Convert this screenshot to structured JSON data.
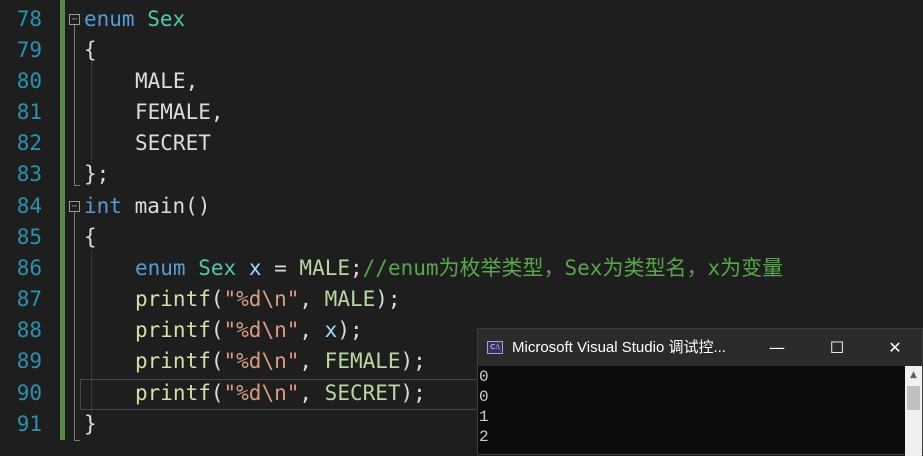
{
  "editor": {
    "line_numbers": [
      "78",
      "79",
      "80",
      "81",
      "82",
      "83",
      "84",
      "85",
      "86",
      "87",
      "88",
      "89",
      "90",
      "91"
    ],
    "code": {
      "l78_kw": "enum",
      "l78_name": "Sex",
      "l79": "{",
      "l80": "MALE,",
      "l81": "FEMALE,",
      "l82": "SECRET",
      "l83": "};",
      "l84_kw": "int",
      "l84_rest": "main()",
      "l85": "{",
      "l86_kw": "enum",
      "l86_type": "Sex",
      "l86_var": "x",
      "l86_eq": " = ",
      "l86_val": "MALE",
      "l86_semi": ";",
      "l86_comment": "//enum为枚举类型，Sex为类型名，x为变量",
      "printf": "printf",
      "open": "(",
      "fmt": "\"%d\\n\"",
      "comma": ", ",
      "close": ");",
      "arg87": "MALE",
      "arg88": "x",
      "arg89": "FEMALE",
      "arg90": "SECRET",
      "l91": "}"
    }
  },
  "console": {
    "title": "Microsoft Visual Studio 调试控...",
    "icon_text": "C:\\",
    "minimize": "—",
    "maximize": "☐",
    "close": "✕",
    "output": [
      "0",
      "0",
      "1",
      "2"
    ],
    "scroll_up": "▲"
  },
  "colors": {
    "keyword": "#569cd6",
    "type": "#4ec9b0",
    "enum_member": "#b8d7a3",
    "string": "#d69d85",
    "comment": "#57a64a",
    "line_number": "#2b91af"
  }
}
